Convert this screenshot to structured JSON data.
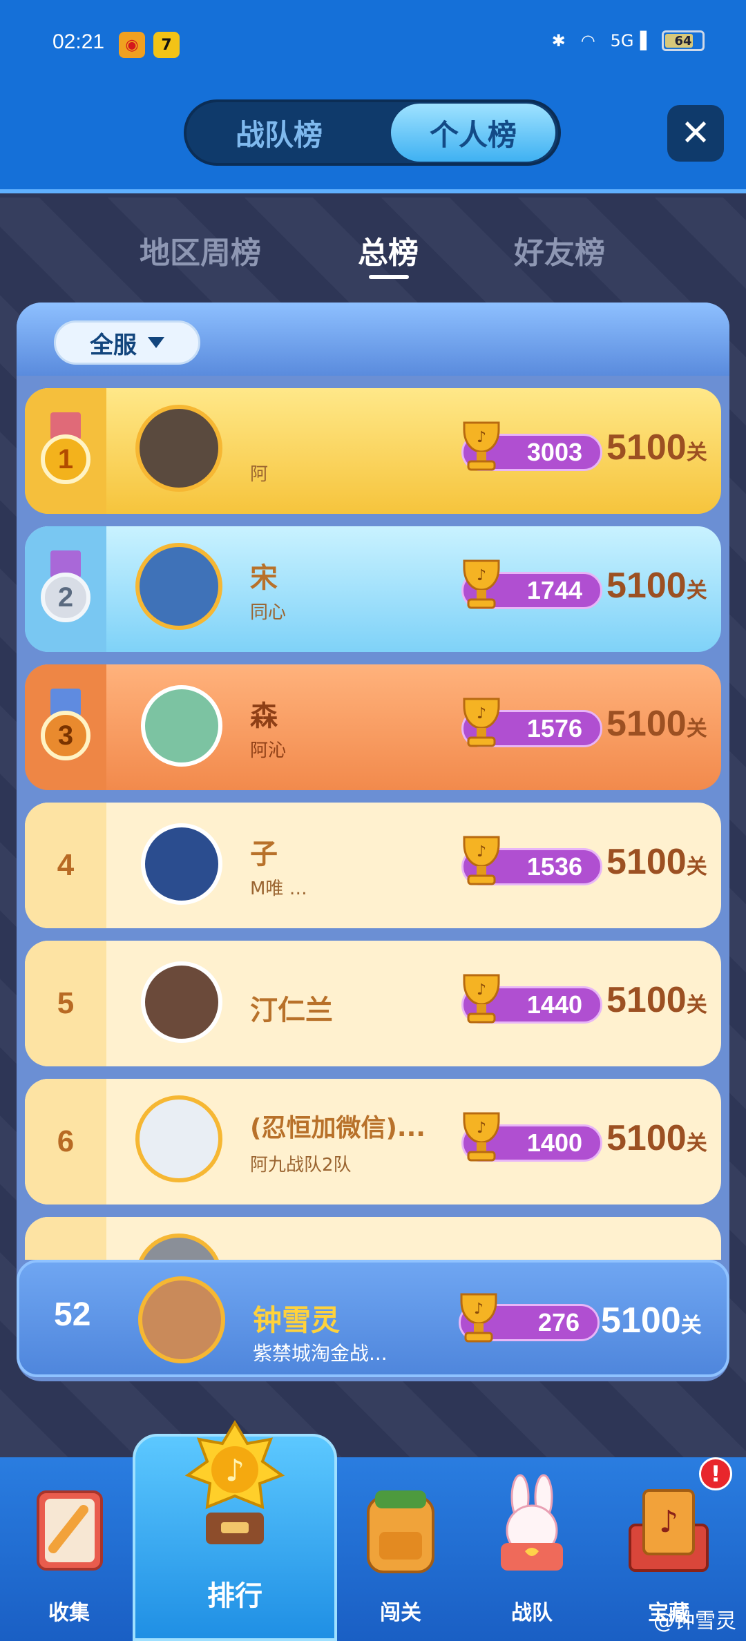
{
  "status": {
    "time": "02:21",
    "network": "5G",
    "battery": "64"
  },
  "tabs": {
    "team": "战队榜",
    "personal": "个人榜"
  },
  "subtabs": {
    "region": "地区周榜",
    "total": "总榜",
    "friends": "好友榜"
  },
  "filter": {
    "server": "全服"
  },
  "rows": [
    {
      "rank": "1",
      "name": "",
      "sub": "阿",
      "cups": "3003",
      "level": "5100",
      "unit": "关"
    },
    {
      "rank": "2",
      "name": "宋",
      "sub": "同心",
      "cups": "1744",
      "level": "5100",
      "unit": "关"
    },
    {
      "rank": "3",
      "name": "森",
      "sub": "阿沁",
      "cups": "1576",
      "level": "5100",
      "unit": "关"
    },
    {
      "rank": "4",
      "name": "子",
      "sub": "M唯 …",
      "cups": "1536",
      "level": "5100",
      "unit": "关"
    },
    {
      "rank": "5",
      "name": "汀仁兰",
      "sub": "",
      "cups": "1440",
      "level": "5100",
      "unit": "关"
    },
    {
      "rank": "6",
      "name": "(忍恒加微信)...",
      "sub": "阿九战队2队",
      "cups": "1400",
      "level": "5100",
      "unit": "关"
    }
  ],
  "me": {
    "rank": "52",
    "name": "钟雪灵",
    "sub": "紫禁城淘金战...",
    "cups": "276",
    "level": "5100",
    "unit": "关"
  },
  "nav": {
    "collect": "收集",
    "rank": "排行",
    "stage": "闯关",
    "team": "战队",
    "treasure": "宝藏",
    "badge": "!"
  },
  "watermark": "@钟雪灵"
}
